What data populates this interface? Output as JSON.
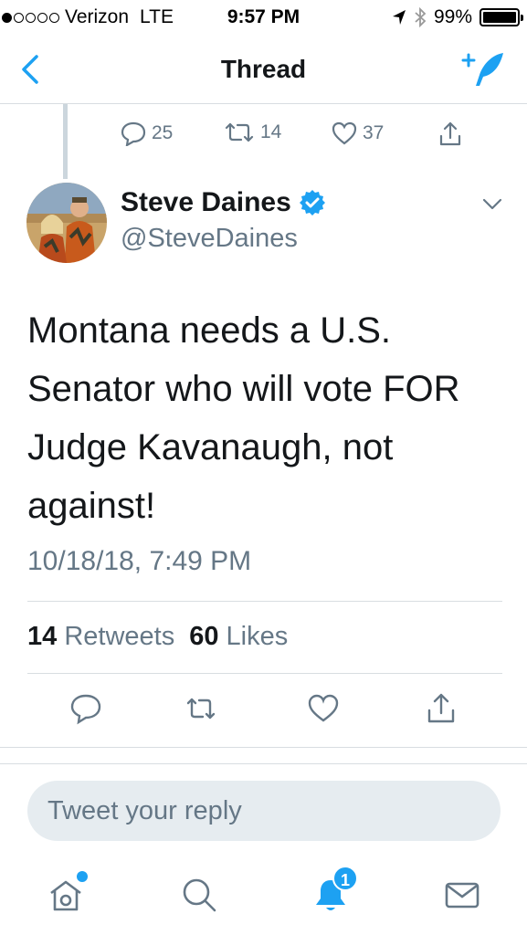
{
  "status_bar": {
    "carrier": "Verizon",
    "network": "LTE",
    "time": "9:57 PM",
    "battery": "99%",
    "battery_level": 0.99,
    "signal_bars": 1
  },
  "nav": {
    "title": "Thread",
    "accent_color": "#1da1f2"
  },
  "previous_tweet": {
    "reply_count": "25",
    "retweet_count": "14",
    "like_count": "37"
  },
  "tweet": {
    "author_name": "Steve Daines",
    "author_handle": "@SteveDaines",
    "verified": true,
    "text": "Montana needs a U.S. Senator who will vote FOR Judge Kavanaugh, not against!",
    "timestamp": "10/18/18, 7:49 PM",
    "retweets_count": "14",
    "retweets_label": "Retweets",
    "likes_count": "60",
    "likes_label": "Likes"
  },
  "reply": {
    "placeholder": "Tweet your reply"
  },
  "tab_bar": {
    "notifications_badge": "1",
    "icons": [
      "home-icon",
      "search-icon",
      "bell-icon",
      "mail-icon"
    ]
  }
}
